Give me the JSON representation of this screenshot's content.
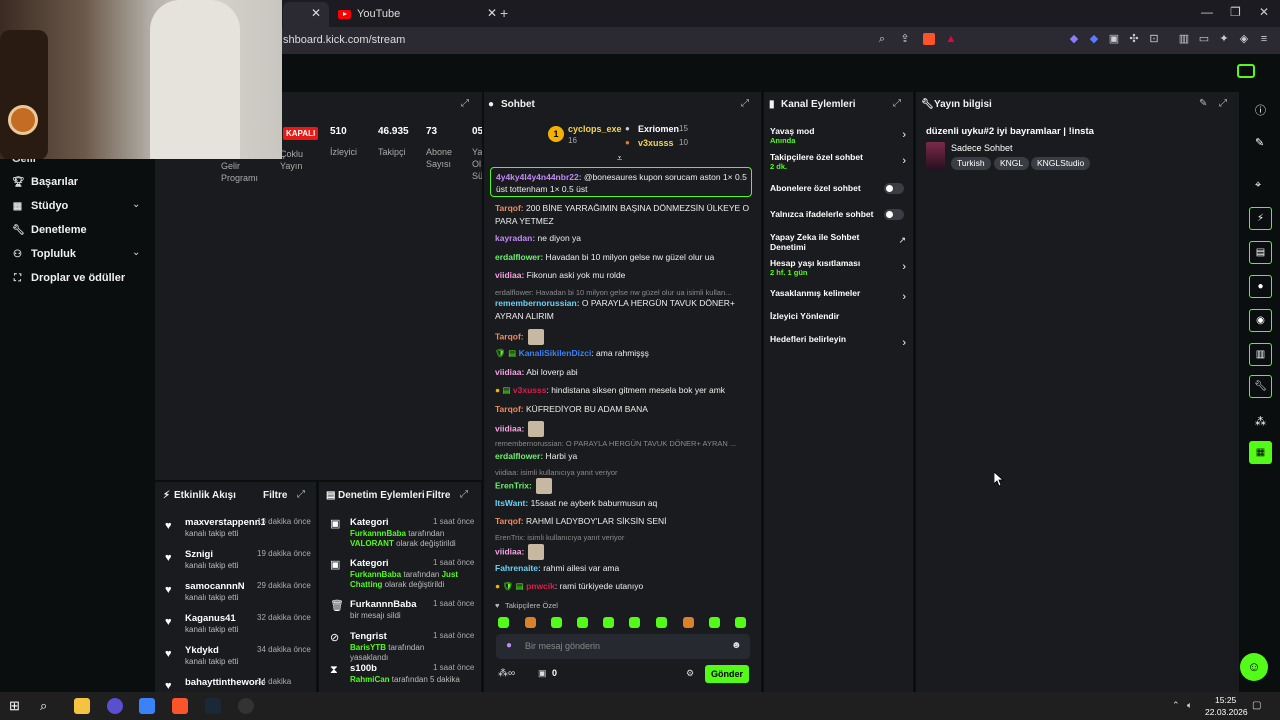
{
  "browser": {
    "tab_youtube": "YouTube",
    "url": "shboard.kick.com/stream"
  },
  "nav": {
    "partial_top": "Gelir",
    "items": [
      {
        "label": "Başarılar",
        "icon": "trophy-icon"
      },
      {
        "label": "Stüdyo",
        "icon": "studio-icon"
      },
      {
        "label": "Denetleme",
        "icon": "wrench-icon"
      },
      {
        "label": "Topluluk",
        "icon": "community-icon"
      },
      {
        "label": "Droplar ve ödüller",
        "icon": "gift-icon"
      }
    ]
  },
  "stats": {
    "kapali": "KAPALI",
    "gelir": "Gelir Programı",
    "coklu": "Çoklu Yayın",
    "viewers_val": "510",
    "viewers_lbl": "İzleyici",
    "followers_val": "46.935",
    "followers_lbl": "Takipçi",
    "subs_val": "73",
    "subs_lbl": "Abone Sayısı",
    "partial_val": "05",
    "partial_lbl": "Yayın Ol Sü"
  },
  "activity": {
    "title": "Etkinlik Akışı",
    "filter": "Filtre",
    "rows": [
      {
        "name": "maxverstappenn1",
        "time": "13 dakika önce",
        "sub": "kanalı takip etti"
      },
      {
        "name": "Sznigi",
        "time": "19 dakika önce",
        "sub": "kanalı takip etti"
      },
      {
        "name": "samocannnN",
        "time": "29 dakika önce",
        "sub": "kanalı takip etti"
      },
      {
        "name": "Kaganus41",
        "time": "32 dakika önce",
        "sub": "kanalı takip etti"
      },
      {
        "name": "Ykdykd",
        "time": "34 dakika önce",
        "sub": "kanalı takip etti"
      },
      {
        "name": "bahayttintheworld",
        "time": "34 dakika",
        "sub": ""
      }
    ]
  },
  "modactions": {
    "title": "Denetim Eylemleri",
    "filter": "Filtre",
    "rows": [
      {
        "title": "Kategori",
        "time": "1 saat önce",
        "user": "FurkannnBaba",
        "mid": " tarafından ",
        "target": "VALORANT",
        "tail": " olarak değiştirildi"
      },
      {
        "title": "Kategori",
        "time": "1 saat önce",
        "user": "FurkannBaba",
        "mid": " tarafından ",
        "target": "Just Chatting",
        "tail": " olarak değiştirildi"
      },
      {
        "title": "FurkannnBaba",
        "time": "1 saat önce",
        "user": "",
        "mid": "bir mesajı sildi",
        "target": "",
        "tail": ""
      },
      {
        "title": "Tengrist",
        "time": "1 saat önce",
        "user": "BarisYTB",
        "mid": " tarafından yasaklandı",
        "target": "",
        "tail": ""
      },
      {
        "title": "s100b",
        "time": "1 saat önce",
        "user": "RahmiCan",
        "mid": " tarafından 5 dakika",
        "target": "",
        "tail": ""
      }
    ]
  },
  "chat": {
    "title": "Sohbet",
    "leaderboard": {
      "first": "cyclops_exe",
      "first_count": "16",
      "second": "Exriomen",
      "second_count": "15",
      "third": "v3xusss",
      "third_count": "10"
    },
    "pinned_user": "4y4ky4l4y4n44nbr22:",
    "pinned_text": " @bonesaures kupon sorucam aston 1× 0.5 üst tottenham 1× 0.5 üst",
    "messages": [
      {
        "user": "Tarqof:",
        "color": "#f08a5d",
        "text": " 200 BİNE YARRAĞIMIN BAŞINA DÖNMEZSİN ÜLKEYE O PARA YETMEZ"
      },
      {
        "user": "kayradan:",
        "color": "#c18bf5",
        "text": " ne diyon ya"
      },
      {
        "user": "erdalflower:",
        "color": "#6cf26c",
        "text": " Havadan bi 10 milyon gelse nw güzel olur ua"
      },
      {
        "user": "viidiaa:",
        "color": "#f5a3e0",
        "text": " Fikonun aski yok mu rolde"
      },
      {
        "user": "remembernorussian:",
        "color": "#6ad3f5",
        "text": " O PARAYLA HERGÜN TAVUK DÖNER+ AYRAN ALIRIM"
      },
      {
        "user": "Tarqof:",
        "color": "#f08a5d",
        "text": ""
      },
      {
        "user": "KanaliSikilenDizci",
        "color": "#3b82f6",
        "text": ": ama rahmişşş"
      },
      {
        "user": "viidiaa:",
        "color": "#f5a3e0",
        "text": " Abi loverp abi"
      },
      {
        "user": "v3xusss",
        "color": "#e11d48",
        "text": ": hindistana siksen gitmem mesela bok yer amk"
      },
      {
        "user": "Tarqof:",
        "color": "#f08a5d",
        "text": " KÜFREDİYOR BU ADAM BANA"
      },
      {
        "user": "viidiaa:",
        "color": "#f5a3e0",
        "text": ""
      },
      {
        "user": "erdalflower:",
        "color": "#6cf26c",
        "text": " Harbi ya"
      },
      {
        "user": "ErenTrix:",
        "color": "#6cf26c",
        "text": ""
      },
      {
        "user": "ItsWant:",
        "color": "#6ad3f5",
        "text": " 15saat ne ayberk baburmusun aq"
      },
      {
        "user": "Tarqof:",
        "color": "#f08a5d",
        "text": " RAHMİ LADYBOY'LAR SİKSİN SENİ"
      },
      {
        "user": "viidiaa:",
        "color": "#f5a3e0",
        "text": ""
      },
      {
        "user": "Fahrenaite:",
        "color": "#6ad3f5",
        "text": " rahmi ailesi var ama"
      },
      {
        "user": "pnwcik",
        "color": "#e11d48",
        "text": ": rami türkiyede utanıyo"
      }
    ],
    "replies": [
      "erdalflower: Havadan bi 10 milyon gelse nw güzel olur ua isimli kullan...",
      "remembernorussian: O PARAYLA HERGÜN TAVUK DÖNER+ AYRAN ...",
      "viidiaa: isimli kullanıcıya yanıt veriyor",
      "ErenTrix: isimli kullanıcıya yanıt veriyor"
    ],
    "followers_only": "Takipçilere Özel",
    "input_placeholder": "Bir mesaj gönderin",
    "count": "0",
    "send": "Gönder"
  },
  "channel_actions": {
    "title": "Kanal Eylemleri",
    "items": [
      {
        "title": "Yavaş mod",
        "sub": "Anında",
        "kind": "chevron"
      },
      {
        "title": "Takipçilere özel sohbet",
        "sub": "2 dk.",
        "kind": "chevron"
      },
      {
        "title": "Abonelere özel sohbet",
        "sub": "",
        "kind": "toggle"
      },
      {
        "title": "Yalnızca ifadelerle sohbet",
        "sub": "",
        "kind": "toggle"
      },
      {
        "title": "Yapay Zeka ile Sohbet Denetimi",
        "sub": "",
        "kind": "external"
      },
      {
        "title": "Hesap yaşı kısıtlaması",
        "sub": "2 hf. 1 gün",
        "kind": "chevron"
      },
      {
        "title": "Yasaklanmış kelimeler",
        "sub": "",
        "kind": "chevron"
      },
      {
        "title": "İzleyici Yönlendir",
        "sub": "",
        "kind": "none"
      },
      {
        "title": "Hedefleri belirleyin",
        "sub": "",
        "kind": "chevron"
      }
    ]
  },
  "stream_info": {
    "title": "Yayın bilgisi",
    "stream_title": "düzenli uyku#2 iyi bayramlaar | !insta",
    "category": "Sadece Sohbet",
    "tags": [
      "Turkish",
      "KNGL",
      "KNGLStudio"
    ]
  },
  "taskbar": {
    "time": "15:25",
    "date": "22.03.2026"
  },
  "colors": {
    "accent": "#53fc18",
    "panel": "#191b1f",
    "background": "#0b0e0f"
  }
}
